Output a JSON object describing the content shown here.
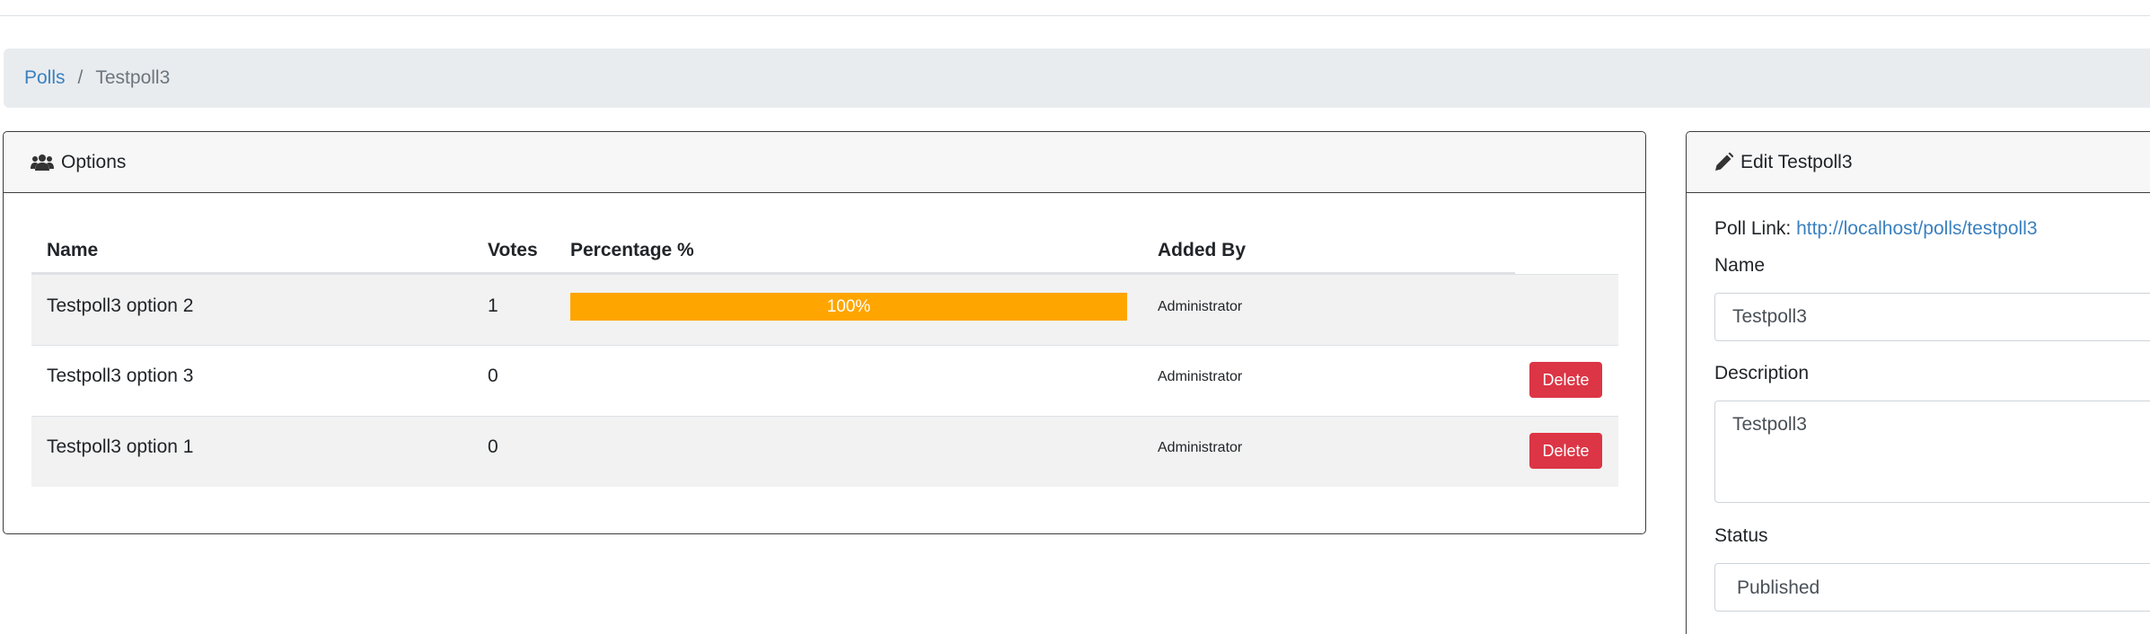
{
  "breadcrumb": {
    "root": "Polls",
    "separator": "/",
    "current": "Testpoll3"
  },
  "options_card": {
    "title": "Options",
    "icon": "users-icon",
    "columns": {
      "name": "Name",
      "votes": "Votes",
      "percentage": "Percentage %",
      "added_by": "Added By"
    },
    "rows": [
      {
        "name": "Testpoll3 option 2",
        "votes": "1",
        "percentage_label": "100%",
        "percentage": 100,
        "added_by": "Administrator",
        "has_delete": false
      },
      {
        "name": "Testpoll3 option 3",
        "votes": "0",
        "percentage_label": "",
        "percentage": 0,
        "added_by": "Administrator",
        "has_delete": true
      },
      {
        "name": "Testpoll3 option 1",
        "votes": "0",
        "percentage_label": "",
        "percentage": 0,
        "added_by": "Administrator",
        "has_delete": true
      }
    ],
    "delete_label": "Delete"
  },
  "edit_card": {
    "title": "Edit Testpoll3",
    "icon": "pencil-icon",
    "poll_link_label": "Poll Link:",
    "poll_link_url": "http://localhost/polls/testpoll3",
    "name_label": "Name",
    "name_value": "Testpoll3",
    "description_label": "Description",
    "description_value": "Testpoll3",
    "status_label": "Status",
    "status_value": "Published"
  },
  "colors": {
    "progress": "#ffa500",
    "danger": "#dc3545",
    "link": "#3a80bf"
  }
}
